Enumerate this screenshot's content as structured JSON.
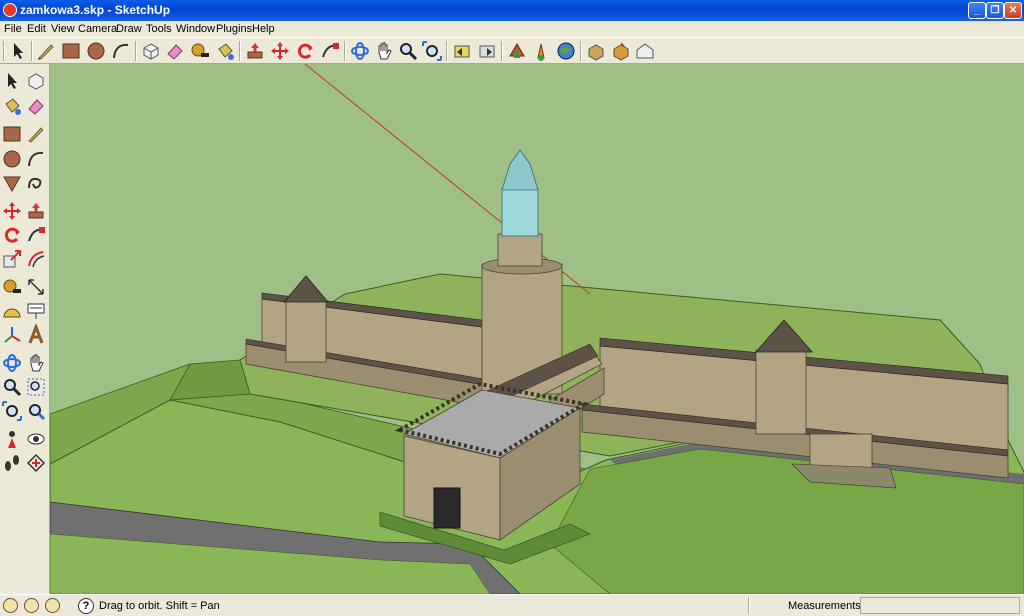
{
  "window": {
    "title": "zamkowa3.skp - SketchUp",
    "minimize_glyph": "_",
    "maximize_glyph": "❐",
    "close_glyph": "✕"
  },
  "menu": [
    "File",
    "Edit",
    "View",
    "Camera",
    "Draw",
    "Tools",
    "Window",
    "Plugins",
    "Help"
  ],
  "toolbar_icons": [
    "select-icon",
    "pencil-icon",
    "rectangle-icon",
    "circle-icon",
    "arc-icon",
    "make-component-icon",
    "eraser-icon",
    "tape-measure-icon",
    "paint-bucket-icon",
    "push-pull-icon",
    "move-icon",
    "rotate-icon",
    "follow-me-icon",
    "orbit-icon",
    "pan-icon",
    "zoom-icon",
    "zoom-extents-icon",
    "previous-view-icon",
    "next-view-icon",
    "get-models-icon",
    "share-model-icon",
    "google-earth-icon",
    "component-icon",
    "share-component-icon",
    "warehouse-icon"
  ],
  "left_tools": [
    "select-icon",
    "make-component-icon",
    "paint-bucket-icon",
    "eraser-icon",
    "rectangle-icon",
    "line-icon",
    "circle-icon",
    "arc-icon",
    "polygon-icon",
    "freehand-icon",
    "move-icon",
    "push-pull-icon",
    "rotate-icon",
    "follow-me-icon",
    "scale-icon",
    "offset-icon",
    "tape-measure-icon",
    "dimension-icon",
    "protractor-icon",
    "text-icon",
    "axes-icon",
    "3d-text-icon",
    "orbit-icon",
    "pan-icon",
    "zoom-icon",
    "zoom-window-icon",
    "zoom-extents-icon",
    "previous-icon",
    "position-camera-icon",
    "look-around-icon",
    "walk-icon",
    "section-plane-icon"
  ],
  "status": {
    "hint": "Drag to orbit.  Shift = Pan",
    "measurements_label": "Measurements",
    "help_glyph": "?"
  },
  "colors": {
    "sky": "#9ebf86",
    "ground_light": "#8fb35a",
    "ground_dark": "#6f9a3f",
    "road": "#6e6e6e",
    "wall": "#b3a583",
    "wall_shade": "#8f8265",
    "roof": "#5d5247",
    "glass": "#9ed9dc",
    "axis_red": "#c0392b"
  }
}
